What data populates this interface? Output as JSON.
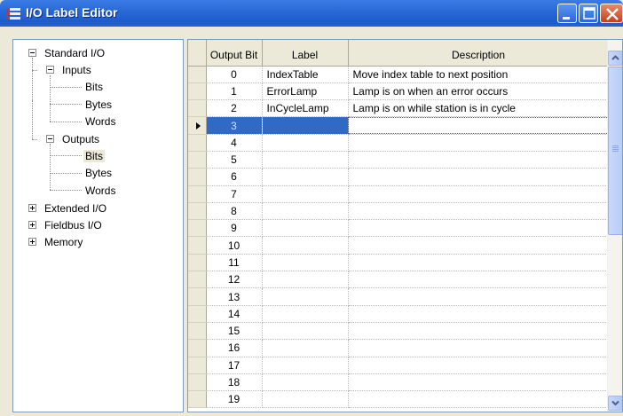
{
  "window": {
    "title": "I/O Label Editor"
  },
  "tree": {
    "nodes": [
      {
        "label": "Standard I/O"
      },
      {
        "label": "Inputs"
      },
      {
        "label": "Bits"
      },
      {
        "label": "Bytes"
      },
      {
        "label": "Words"
      },
      {
        "label": "Outputs"
      },
      {
        "label": "Bits"
      },
      {
        "label": "Bytes"
      },
      {
        "label": "Words"
      },
      {
        "label": "Extended I/O"
      },
      {
        "label": "Fieldbus I/O"
      },
      {
        "label": "Memory"
      }
    ],
    "selected": "Outputs > Bits"
  },
  "grid": {
    "columns": [
      "Output Bit",
      "Label",
      "Description"
    ],
    "rows": [
      {
        "bit": "0",
        "label": "IndexTable",
        "description": "Move index table to next position"
      },
      {
        "bit": "1",
        "label": "ErrorLamp",
        "description": "Lamp is on when an error occurs"
      },
      {
        "bit": "2",
        "label": "InCycleLamp",
        "description": "Lamp is on while station is in cycle"
      },
      {
        "bit": "3",
        "label": "",
        "description": ""
      },
      {
        "bit": "4",
        "label": "",
        "description": ""
      },
      {
        "bit": "5",
        "label": "",
        "description": ""
      },
      {
        "bit": "6",
        "label": "",
        "description": ""
      },
      {
        "bit": "7",
        "label": "",
        "description": ""
      },
      {
        "bit": "8",
        "label": "",
        "description": ""
      },
      {
        "bit": "9",
        "label": "",
        "description": ""
      },
      {
        "bit": "10",
        "label": "",
        "description": ""
      },
      {
        "bit": "11",
        "label": "",
        "description": ""
      },
      {
        "bit": "12",
        "label": "",
        "description": ""
      },
      {
        "bit": "13",
        "label": "",
        "description": ""
      },
      {
        "bit": "14",
        "label": "",
        "description": ""
      },
      {
        "bit": "15",
        "label": "",
        "description": ""
      },
      {
        "bit": "16",
        "label": "",
        "description": ""
      },
      {
        "bit": "17",
        "label": "",
        "description": ""
      },
      {
        "bit": "18",
        "label": "",
        "description": ""
      },
      {
        "bit": "19",
        "label": "",
        "description": ""
      }
    ],
    "selected_row": "3"
  },
  "colors": {
    "title_bar": "#2a6ad6",
    "selection": "#316ac5",
    "close_button": "#c5401c"
  }
}
